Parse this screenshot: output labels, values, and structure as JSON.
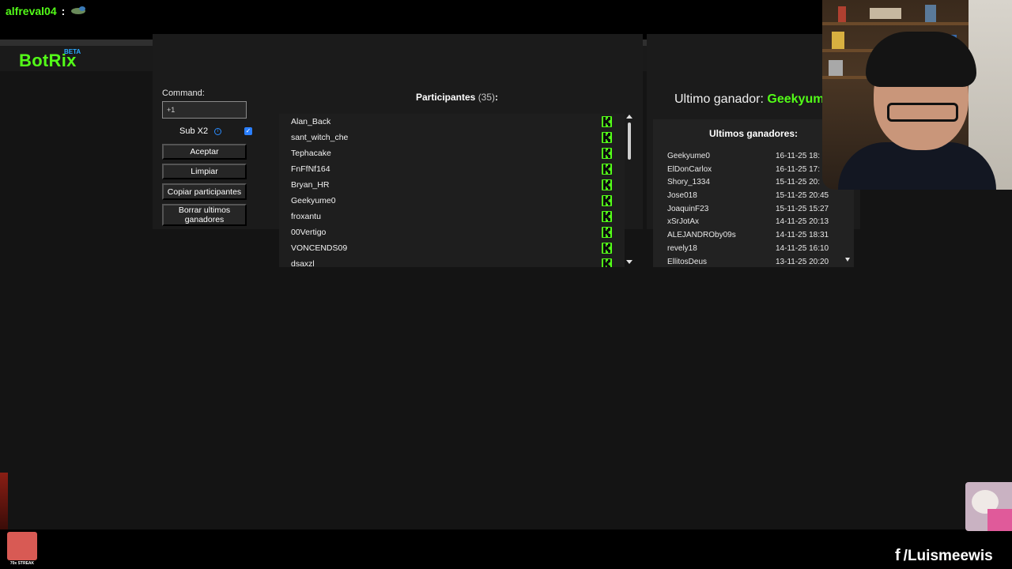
{
  "chat": {
    "username": "alfreval04",
    "separator": ":",
    "emote": "frog-emote"
  },
  "app": {
    "logo": "BotRix",
    "badge": "BETA"
  },
  "controls": {
    "command_label": "Command:",
    "command_value": "+1",
    "sub_label": "Sub X2",
    "sub_checked": true,
    "info_icon": "info-icon",
    "buttons": {
      "accept": "Aceptar",
      "clear": "Limpiar",
      "copy": "Copiar participantes",
      "delete": "Borrar ultimos ganadores"
    }
  },
  "participants": {
    "title": "Participantes",
    "count": "(35)",
    "colon": ":",
    "platform_icon": "kick-icon",
    "items": [
      {
        "name": "Alan_Back"
      },
      {
        "name": "sant_witch_che"
      },
      {
        "name": "Tephacake"
      },
      {
        "name": "FnFfNf164"
      },
      {
        "name": "Bryan_HR"
      },
      {
        "name": "Geekyume0"
      },
      {
        "name": "froxantu"
      },
      {
        "name": "00Vertigo"
      },
      {
        "name": "VONCENDS09"
      },
      {
        "name": "dsaxzl"
      }
    ]
  },
  "winners": {
    "last_label": "Ultimo ganador:",
    "last_name": "Geekyume",
    "list_title": "Ultimos ganadores:",
    "items": [
      {
        "name": "Geekyume0",
        "date": "16-11-25 18:"
      },
      {
        "name": "ElDonCarlox",
        "date": "16-11-25 17:"
      },
      {
        "name": "Shory_1334",
        "date": "15-11-25 20:"
      },
      {
        "name": "Jose018",
        "date": "15-11-25 20:45"
      },
      {
        "name": "JoaquinF23",
        "date": "15-11-25 15:27"
      },
      {
        "name": "xSrJotAx",
        "date": "14-11-25 20:13"
      },
      {
        "name": "ALEJANDROby09s",
        "date": "14-11-25 18:31"
      },
      {
        "name": "revely18",
        "date": "14-11-25 16:10"
      },
      {
        "name": "EllitosDeus",
        "date": "13-11-25 20:20"
      }
    ]
  },
  "overlay": {
    "streak_label": "70x STREAK",
    "social_handle": "/Luismeewis",
    "social_icon": "f"
  },
  "colors": {
    "accent_green": "#53fc18",
    "beta_blue": "#2aa8ff",
    "checkbox_blue": "#2a7fff"
  }
}
